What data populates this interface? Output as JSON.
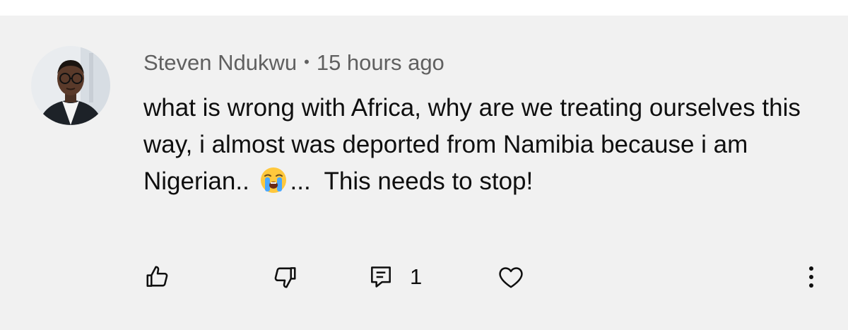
{
  "comment": {
    "author": "Steven Ndukwu",
    "separator": "•",
    "time": "15 hours ago",
    "text_before_emoji": "what is wrong with Africa, why are we treating ourselves this way, i almost was deported from Namibia because i am Nigerian.. ",
    "emoji": "loudly-crying-face-emoji",
    "text_after_emoji": "...  This needs to stop!"
  },
  "actions": {
    "like_icon": "thumbs-up-icon",
    "dislike_icon": "thumbs-down-icon",
    "reply_icon": "comment-icon",
    "reply_count": "1",
    "heart_icon": "heart-icon",
    "more_icon": "more-vertical-icon"
  },
  "colors": {
    "card_background": "#f1f1f1",
    "text_primary": "#0f0f0f",
    "text_secondary": "#606060"
  }
}
